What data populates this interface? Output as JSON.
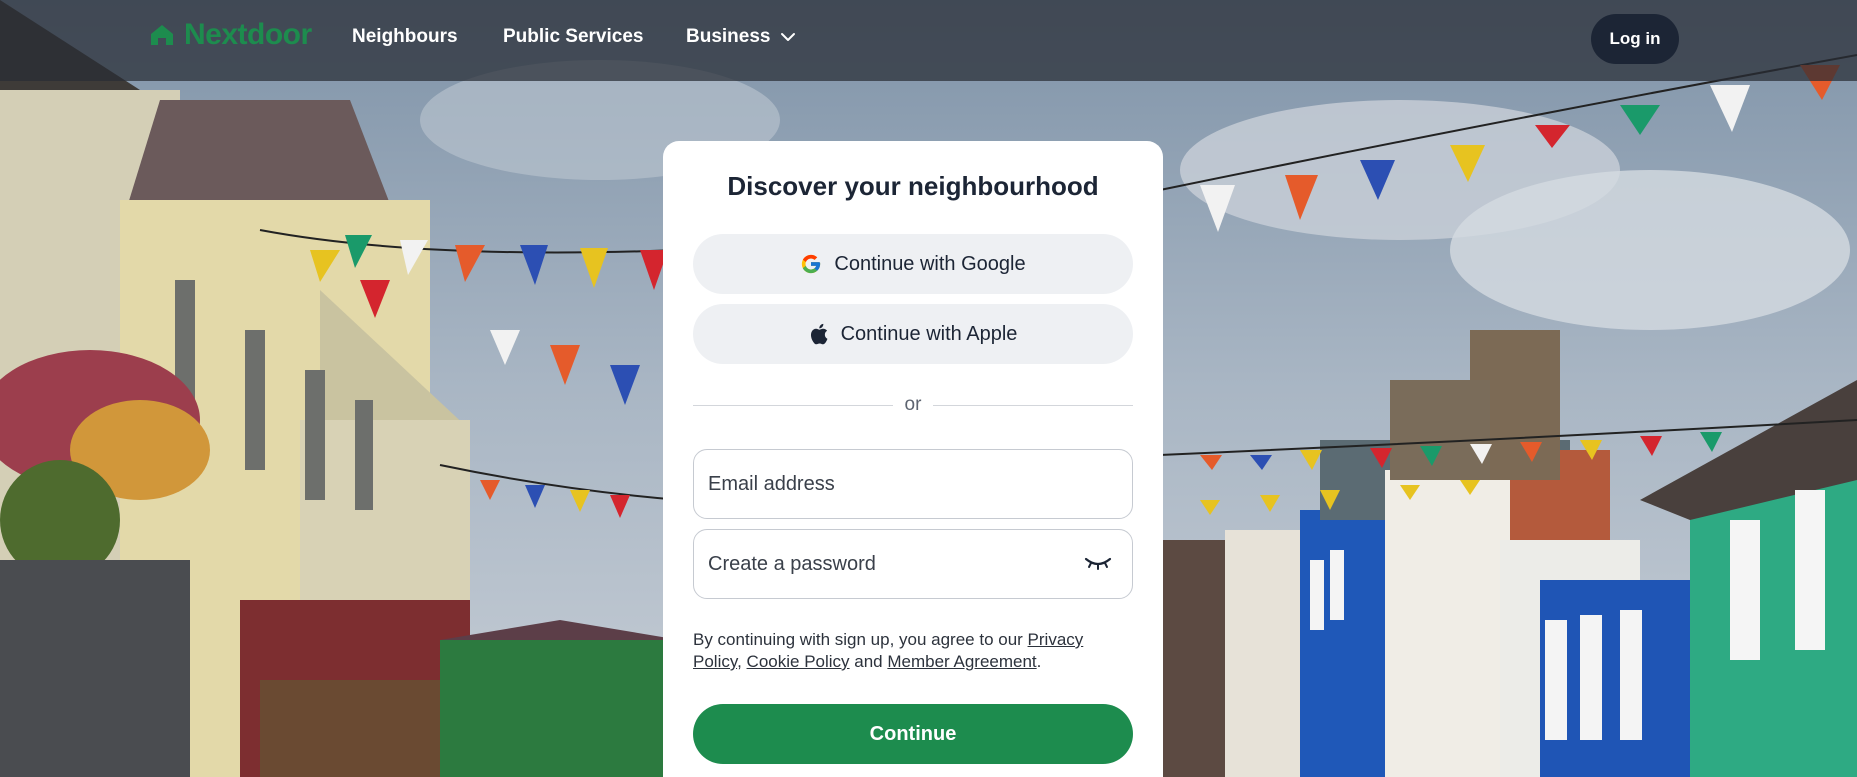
{
  "brand": {
    "name": "Nextdoor",
    "color": "#1d8c4e",
    "icon": "house-logo-icon"
  },
  "nav": {
    "items": [
      {
        "label": "Neighbours"
      },
      {
        "label": "Public Services"
      },
      {
        "label": "Business",
        "icon": "chevron-down-icon"
      }
    ],
    "login_label": "Log in"
  },
  "card": {
    "title": "Discover your neighbourhood",
    "google_label": "Continue with Google",
    "apple_label": "Continue with Apple",
    "divider_text": "or",
    "email_placeholder": "Email address",
    "password_placeholder": "Create a password",
    "password_icon": "eye-closed-icon",
    "legal": {
      "prefix": "By continuing with sign up, you agree to our ",
      "privacy": "Privacy Policy",
      "comma": ", ",
      "cookie": "Cookie Policy",
      "and": " and ",
      "member": "Member Agreement",
      "suffix": "."
    },
    "continue_label": "Continue"
  },
  "colors": {
    "accent": "#1d8c4e",
    "login_bg": "#1c2535",
    "social_bg": "#eef0f3"
  }
}
